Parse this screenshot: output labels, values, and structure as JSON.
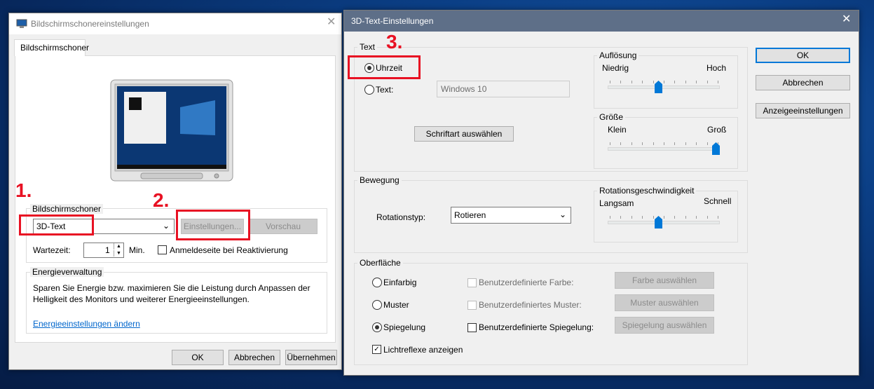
{
  "left_dialog": {
    "title": "Bildschirmschonereinstellungen",
    "tab": "Bildschirmschoner",
    "screensaver_group": {
      "label": "Bildschirmschoner",
      "selected": "3D-Text",
      "settings_button": "Einstellungen...",
      "preview_button": "Vorschau",
      "wait_label": "Wartezeit:",
      "wait_value": "1",
      "wait_unit": "Min.",
      "logon_checkbox": "Anmeldeseite bei Reaktivierung"
    },
    "energy_group": {
      "label": "Energieverwaltung",
      "text": "Sparen Sie Energie bzw. maximieren Sie die Leistung durch Anpassen der Helligkeit des Monitors und weiterer Energieeinstellungen.",
      "link": "Energieeinstellungen ändern"
    },
    "buttons": {
      "ok": "OK",
      "cancel": "Abbrechen",
      "apply": "Übernehmen"
    }
  },
  "right_dialog": {
    "title": "3D-Text-Einstellungen",
    "text_group": {
      "label": "Text",
      "option_time": "Uhrzeit",
      "option_text": "Text:",
      "text_value": "Windows 10",
      "font_button": "Schriftart auswählen"
    },
    "resolution": {
      "label": "Auflösung",
      "min": "Niedrig",
      "max": "Hoch",
      "level": 0.45
    },
    "size": {
      "label": "Größe",
      "min": "Klein",
      "max": "Groß",
      "level": 1.0
    },
    "motion_group": {
      "label": "Bewegung",
      "rotation_type_label": "Rotationstyp:",
      "rotation_type_value": "Rotieren",
      "rotation_speed": {
        "label": "Rotationsgeschwindigkeit",
        "min": "Langsam",
        "max": "Schnell",
        "level": 0.45
      }
    },
    "surface_group": {
      "label": "Oberfläche",
      "opt_solid": "Einfarbig",
      "opt_pattern": "Muster",
      "opt_reflection": "Spiegelung",
      "chk_color": "Benutzerdefinierte Farbe:",
      "chk_pattern": "Benutzerdefiniertes Muster:",
      "chk_reflection": "Benutzerdefinierte Spiegelung:",
      "btn_color": "Farbe auswählen",
      "btn_pattern": "Muster auswählen",
      "btn_reflection": "Spiegelung auswählen",
      "chk_highlights": "Lichtreflexe anzeigen"
    },
    "buttons": {
      "ok": "OK",
      "cancel": "Abbrechen",
      "display": "Anzeigeeinstellungen"
    }
  },
  "annotations": {
    "step1": "1.",
    "step2": "2.",
    "step3": "3."
  },
  "colors": {
    "annotation_red": "#e81123",
    "accent_blue": "#0078d7"
  }
}
